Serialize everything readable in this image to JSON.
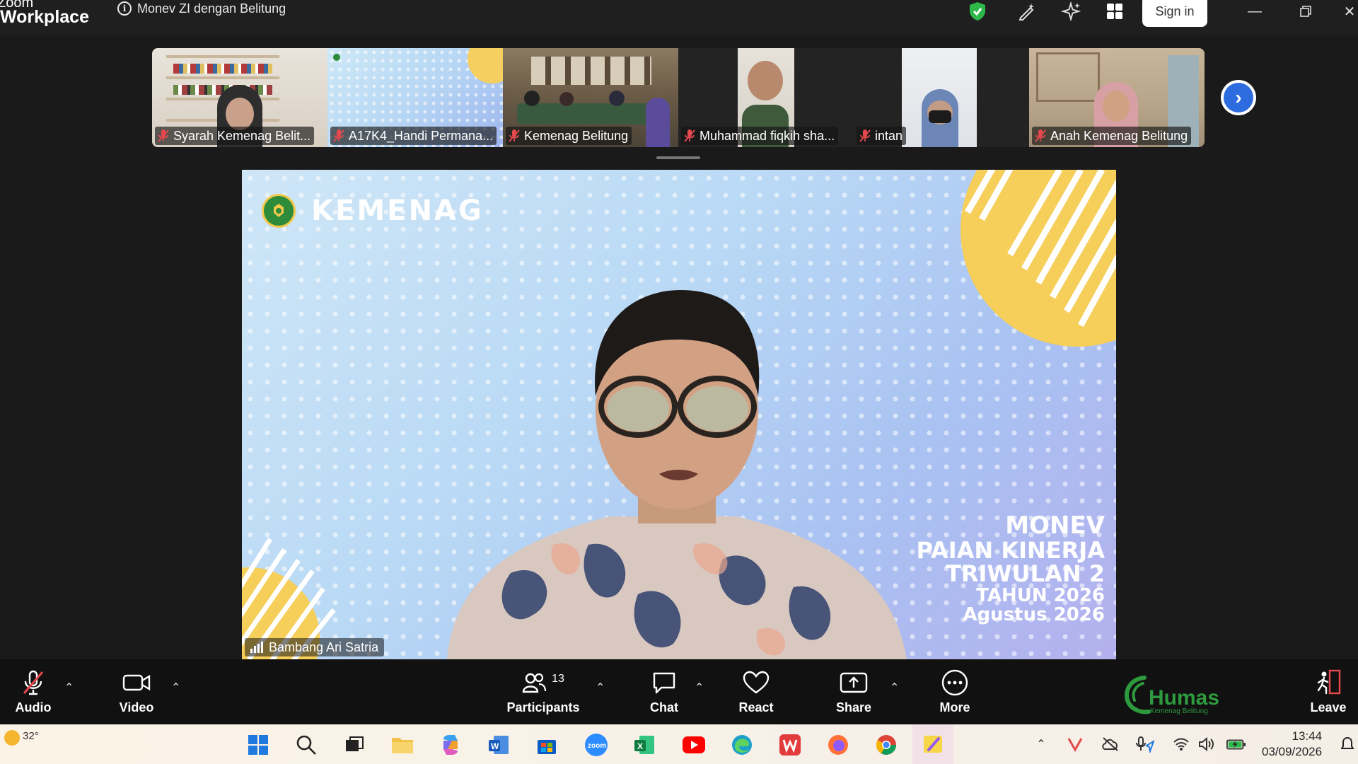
{
  "app": {
    "brand_top": "Zoom",
    "brand_bottom": "Workplace"
  },
  "meeting": {
    "title": "Monev ZI dengan Belitung"
  },
  "header": {
    "signin_label": "Sign in"
  },
  "thumbnails": [
    {
      "name": "Syarah Kemenag Belit..."
    },
    {
      "name": "A17K4_Handi Permana..."
    },
    {
      "name": "Kemenag Belitung"
    },
    {
      "name": "Muhammad fiqkih sha..."
    },
    {
      "name": "intan"
    },
    {
      "name": "Anah Kemenag Belitung"
    }
  ],
  "main_video": {
    "logo_text": "KEMENAG",
    "slide_lines": [
      "MONEV",
      "PAIAN KINERJA",
      "TRIWULAN 2",
      "TAHUN 2026",
      "Agustus 2026"
    ],
    "speaker": "Bambang Ari Satria"
  },
  "toolbar": {
    "audio": "Audio",
    "video": "Video",
    "participants": "Participants",
    "participants_count": "13",
    "chat": "Chat",
    "react": "React",
    "share": "Share",
    "more": "More",
    "leave": "Leave",
    "humas_title": "Humas",
    "humas_sub": "Kemenag Belitung"
  },
  "taskbar": {
    "temperature": "32°",
    "time": "13:44",
    "date": "03/09/2026"
  },
  "colors": {
    "accent_blue": "#2d6cdf",
    "muted_red": "#e5484d",
    "shield_green": "#2fb84a",
    "humas_green": "#2e9a3e"
  }
}
